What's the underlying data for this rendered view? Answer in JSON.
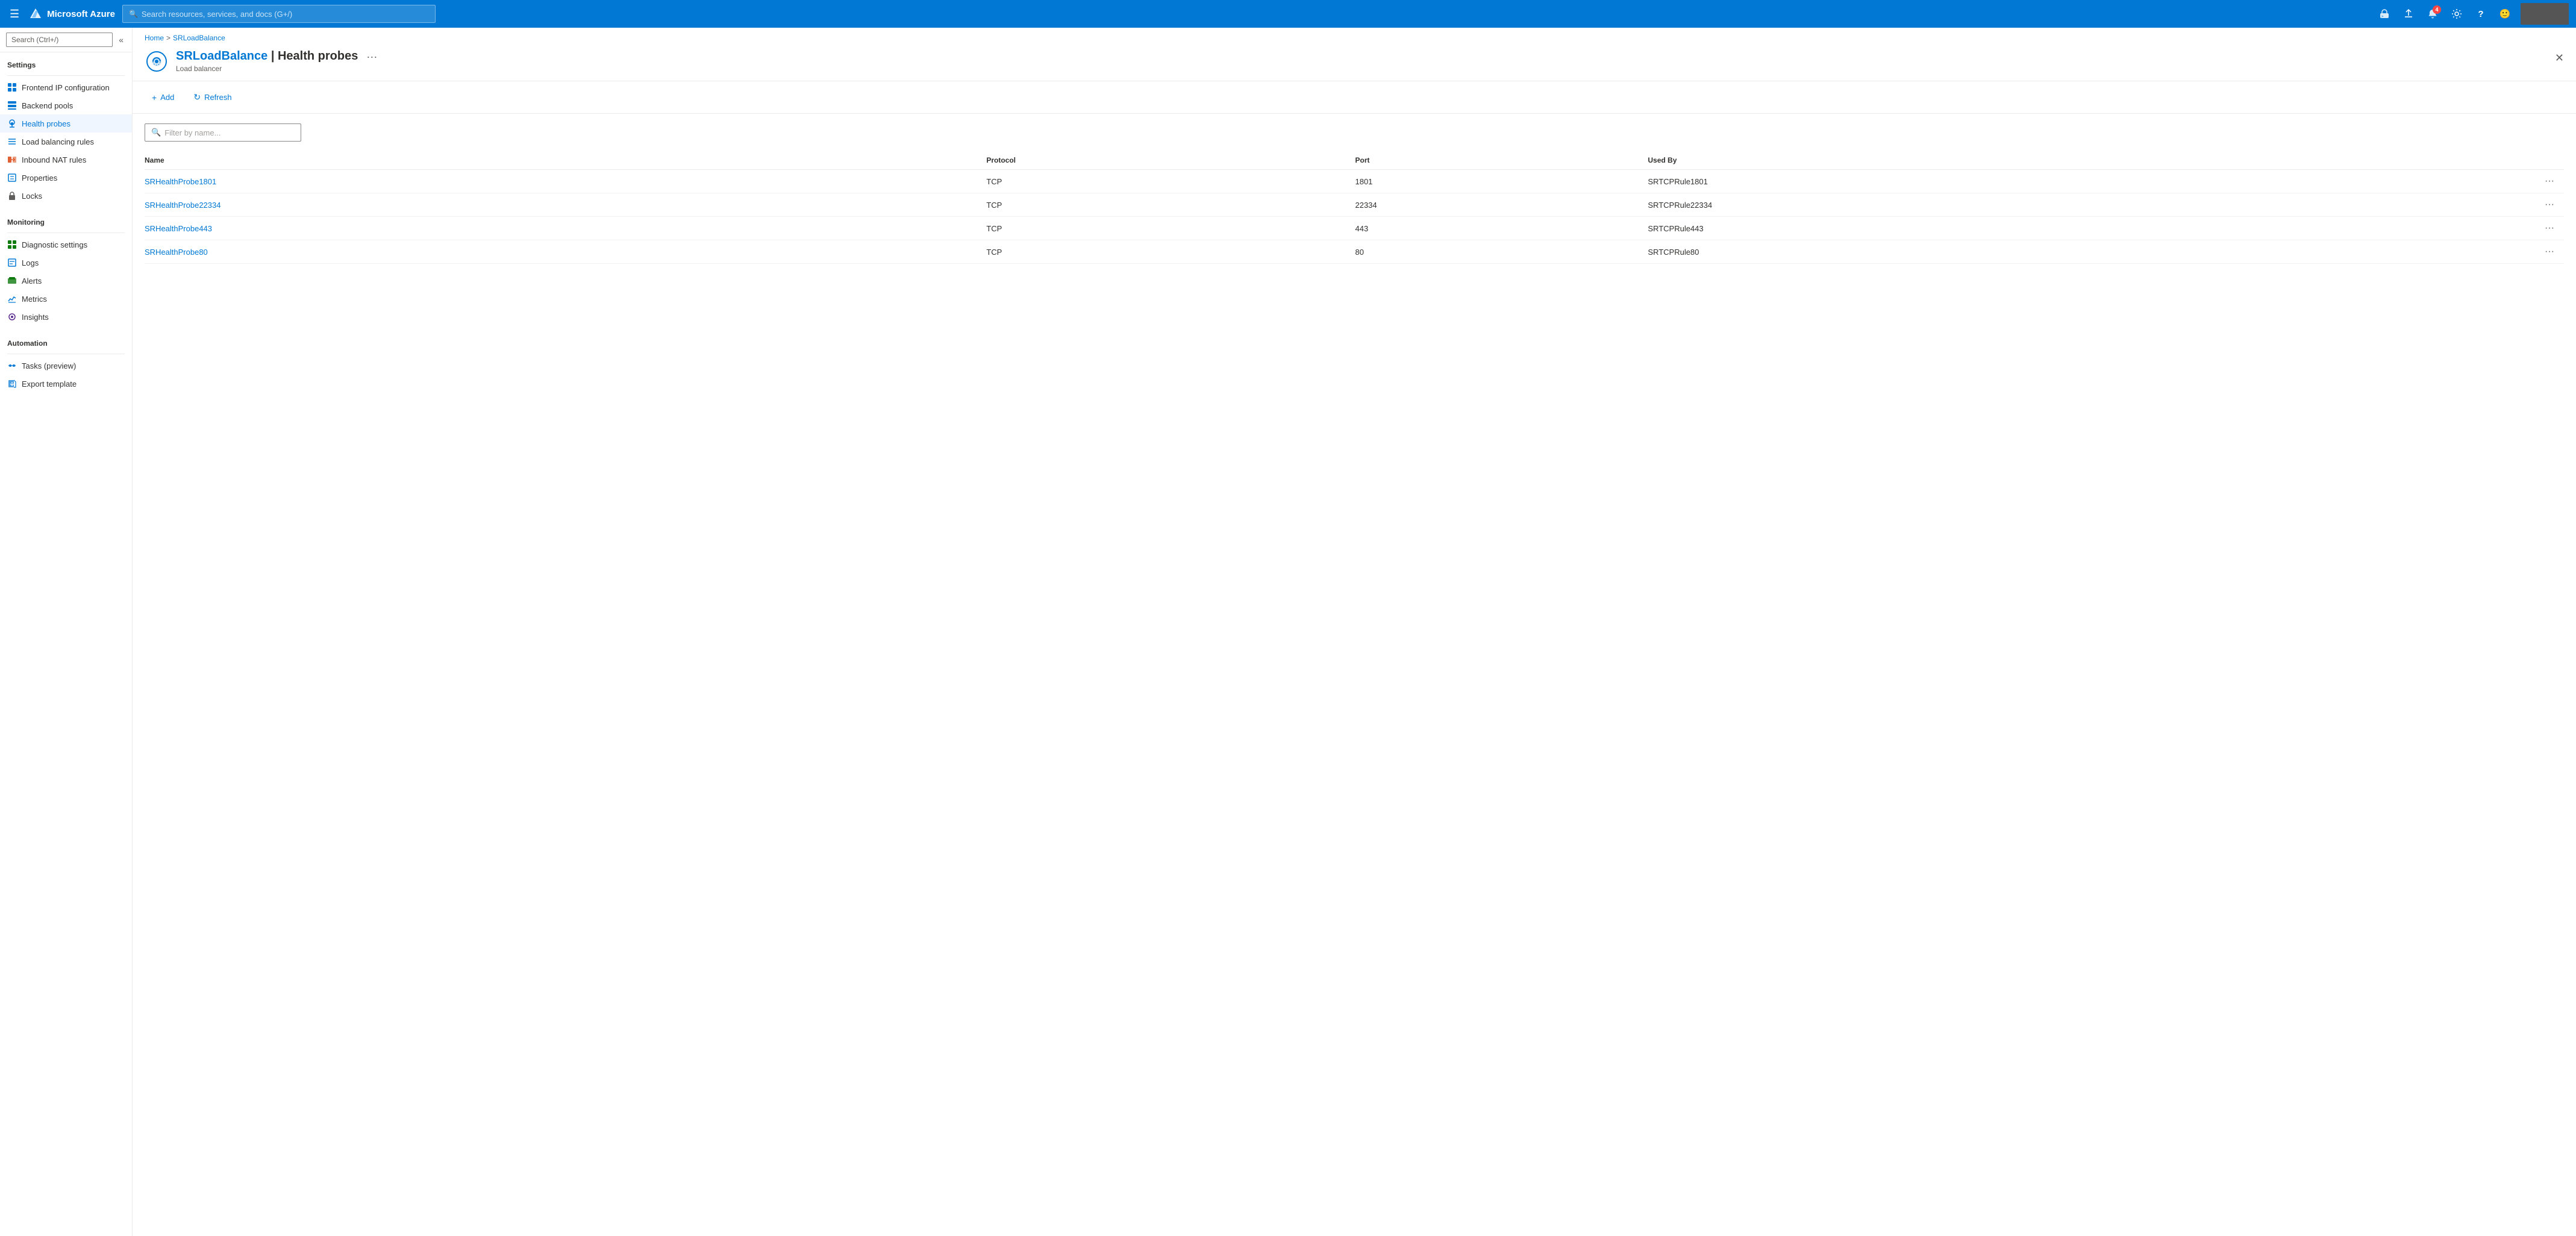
{
  "topbar": {
    "hamburger_label": "☰",
    "logo_text": "Microsoft Azure",
    "search_placeholder": "Search resources, services, and docs (G+/)",
    "notification_count": "4",
    "icons": {
      "cloud": "⬡",
      "download": "⬇",
      "bell": "🔔",
      "gear": "⚙",
      "help": "?",
      "smile": "🙂"
    }
  },
  "breadcrumb": {
    "home": "Home",
    "sep1": ">",
    "resource": "SRLoadBalance"
  },
  "page_header": {
    "title_prefix": "SRLoadBalance",
    "title_separator": " | ",
    "title_page": "Health probes",
    "subtitle": "Load balancer",
    "menu_label": "···"
  },
  "sidebar": {
    "search_placeholder": "Search (Ctrl+/)",
    "collapse_icon": "«",
    "sections": [
      {
        "title": "Settings",
        "items": [
          {
            "id": "frontend-ip",
            "label": "Frontend IP configuration",
            "icon": "grid",
            "icon_color": "blue"
          },
          {
            "id": "backend-pools",
            "label": "Backend pools",
            "icon": "layers",
            "icon_color": "blue"
          },
          {
            "id": "health-probes",
            "label": "Health probes",
            "icon": "wifi",
            "icon_color": "blue",
            "active": true
          },
          {
            "id": "load-balancing-rules",
            "label": "Load balancing rules",
            "icon": "lines",
            "icon_color": "blue"
          },
          {
            "id": "inbound-nat-rules",
            "label": "Inbound NAT rules",
            "icon": "nat",
            "icon_color": "orange"
          },
          {
            "id": "properties",
            "label": "Properties",
            "icon": "props",
            "icon_color": "blue"
          },
          {
            "id": "locks",
            "label": "Locks",
            "icon": "lock",
            "icon_color": "gray"
          }
        ]
      },
      {
        "title": "Monitoring",
        "items": [
          {
            "id": "diagnostic-settings",
            "label": "Diagnostic settings",
            "icon": "diag",
            "icon_color": "green"
          },
          {
            "id": "logs",
            "label": "Logs",
            "icon": "logs",
            "icon_color": "blue"
          },
          {
            "id": "alerts",
            "label": "Alerts",
            "icon": "alerts",
            "icon_color": "green"
          },
          {
            "id": "metrics",
            "label": "Metrics",
            "icon": "metrics",
            "icon_color": "blue"
          },
          {
            "id": "insights",
            "label": "Insights",
            "icon": "insights",
            "icon_color": "purple"
          }
        ]
      },
      {
        "title": "Automation",
        "items": [
          {
            "id": "tasks",
            "label": "Tasks (preview)",
            "icon": "tasks",
            "icon_color": "blue"
          },
          {
            "id": "export-template",
            "label": "Export template",
            "icon": "export",
            "icon_color": "blue"
          }
        ]
      }
    ]
  },
  "toolbar": {
    "add_label": "Add",
    "refresh_label": "Refresh",
    "add_icon": "+",
    "refresh_icon": "↻"
  },
  "filter": {
    "placeholder": "Filter by name..."
  },
  "table": {
    "columns": [
      "Name",
      "Protocol",
      "Port",
      "Used By"
    ],
    "rows": [
      {
        "name": "SRHealthProbe1801",
        "protocol": "TCP",
        "port": "1801",
        "used_by": "SRTCPRule1801"
      },
      {
        "name": "SRHealthProbe22334",
        "protocol": "TCP",
        "port": "22334",
        "used_by": "SRTCPRule22334"
      },
      {
        "name": "SRHealthProbe443",
        "protocol": "TCP",
        "port": "443",
        "used_by": "SRTCPRule443"
      },
      {
        "name": "SRHealthProbe80",
        "protocol": "TCP",
        "port": "80",
        "used_by": "SRTCPRule80"
      }
    ],
    "row_actions": "···"
  }
}
